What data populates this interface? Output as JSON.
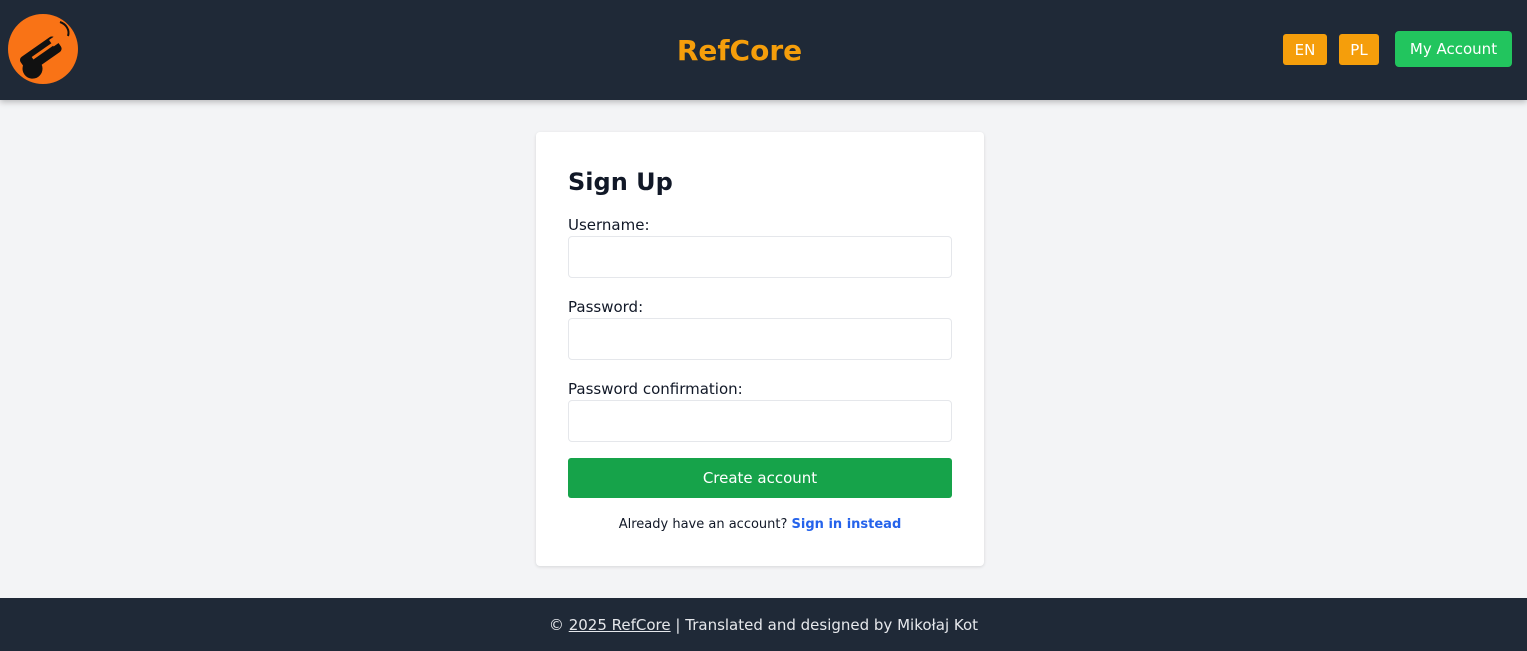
{
  "header": {
    "logo_icon": "whistle-icon",
    "brand": "RefCore",
    "lang_en": "EN",
    "lang_pl": "PL",
    "account_button": "My Account",
    "colors": {
      "bar": "#1f2937",
      "accent": "#f59e0b",
      "account": "#22c55e"
    }
  },
  "form": {
    "title": "Sign Up",
    "username_label": "Username:",
    "username_value": "",
    "password_label": "Password:",
    "password_value": "",
    "confirmation_label": "Password confirmation:",
    "confirmation_value": "",
    "submit": "Create account",
    "signin_prompt": "Already have an account?",
    "signin_link": "Sign in instead",
    "colors": {
      "submit": "#16a34a",
      "link": "#2563eb"
    }
  },
  "footer": {
    "copyright_symbol": "©",
    "copyright_link": "2025 RefCore",
    "separator": "|",
    "credit": "Translated and designed by Mikołaj Kot"
  }
}
